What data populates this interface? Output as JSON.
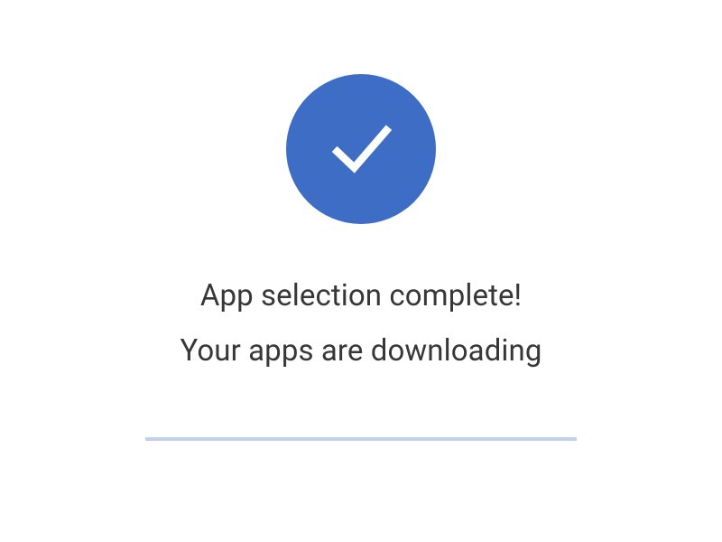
{
  "badge": {
    "color": "#3d6dc4",
    "icon_name": "checkmark"
  },
  "title": "App selection complete!",
  "subtitle": "Your apps are downloading",
  "progress": {
    "track_color": "#c1d1ec"
  }
}
